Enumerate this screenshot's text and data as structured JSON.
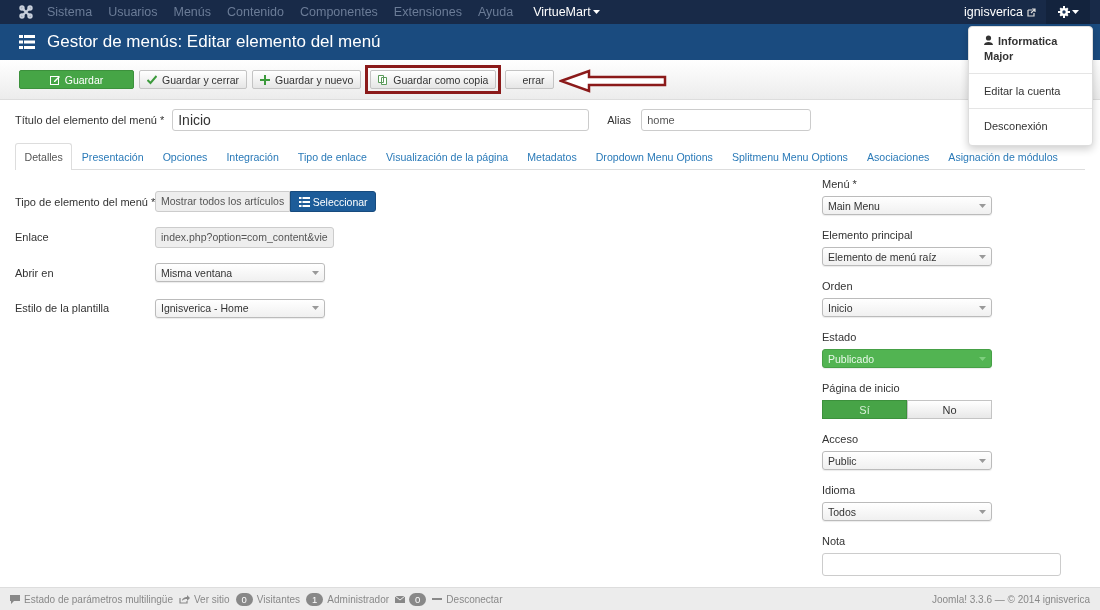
{
  "nav": {
    "items": [
      "Sistema",
      "Usuarios",
      "Menús",
      "Contenido",
      "Componentes",
      "Extensiones",
      "Ayuda"
    ],
    "extra_menu": "VirtueMart",
    "site_link": "ignisverica"
  },
  "user_menu": {
    "name": "Informatica Major",
    "items": [
      "Editar la cuenta",
      "Desconexión"
    ]
  },
  "header": {
    "title": "Gestor de menús: Editar elemento del menú"
  },
  "toolbar": [
    {
      "label": "Guardar",
      "kind": "save",
      "highlighted": false
    },
    {
      "label": "Guardar y cerrar",
      "kind": "save-close",
      "highlighted": false
    },
    {
      "label": "Guardar y nuevo",
      "kind": "save-new",
      "highlighted": false
    },
    {
      "label": "Guardar como copia",
      "kind": "save-copy",
      "highlighted": true
    },
    {
      "label": "errar",
      "kind": "close",
      "highlighted": false
    }
  ],
  "title_row": {
    "title_label": "Título del elemento del menú *",
    "title_value": "Inicio",
    "alias_label": "Alias",
    "alias_value": "home"
  },
  "tabs": [
    {
      "label": "Detalles",
      "selected": true
    },
    {
      "label": "Presentación",
      "selected": false
    },
    {
      "label": "Opciones",
      "selected": false
    },
    {
      "label": "Integración",
      "selected": false
    },
    {
      "label": "Tipo de enlace",
      "selected": false
    },
    {
      "label": "Visualización de la página",
      "selected": false
    },
    {
      "label": "Metadatos",
      "selected": false
    },
    {
      "label": "Dropdown Menu Options",
      "selected": false
    },
    {
      "label": "Splitmenu Menu Options",
      "selected": false
    },
    {
      "label": "Asociaciones",
      "selected": false
    },
    {
      "label": "Asignación de módulos",
      "selected": false
    }
  ],
  "left_fields": [
    {
      "label": "Tipo de elemento del menú *",
      "kind": "picker",
      "value": "Mostrar todos los artículos",
      "button": "Seleccionar"
    },
    {
      "label": "Enlace",
      "kind": "readonly",
      "value": "index.php?option=com_content&vie"
    },
    {
      "label": "Abrir en",
      "kind": "select",
      "value": "Misma ventana"
    },
    {
      "label": "Estilo de la plantilla",
      "kind": "select",
      "value": "Ignisverica - Home"
    }
  ],
  "right_fields": [
    {
      "label": "Menú *",
      "kind": "select",
      "value": "Main Menu"
    },
    {
      "label": "Elemento principal",
      "kind": "select",
      "value": "Elemento de menú raíz"
    },
    {
      "label": "Orden",
      "kind": "select",
      "value": "Inicio"
    },
    {
      "label": "Estado",
      "kind": "status",
      "value": "Publicado"
    },
    {
      "label": "Página de inicio",
      "kind": "toggle",
      "options": [
        {
          "label": "Sí",
          "selected": true
        },
        {
          "label": "No",
          "selected": false
        }
      ]
    },
    {
      "label": "Acceso",
      "kind": "select",
      "value": "Public"
    },
    {
      "label": "Idioma",
      "kind": "select",
      "value": "Todos"
    },
    {
      "label": "Nota",
      "kind": "text"
    }
  ],
  "status_bar": {
    "items": [
      {
        "kind": "comment",
        "text": "Estado de parámetros multilingüe"
      },
      {
        "kind": "share",
        "text": "Ver sitio"
      },
      {
        "kind": "badge",
        "count": "0",
        "text": "Visitantes"
      },
      {
        "kind": "badge",
        "count": "1",
        "text": "Administrador"
      },
      {
        "kind": "mail",
        "count": "0"
      },
      {
        "kind": "dash",
        "text": "Desconectar"
      }
    ],
    "version": "Joomla! 3.3.6 — © 2014 ignisverica"
  }
}
